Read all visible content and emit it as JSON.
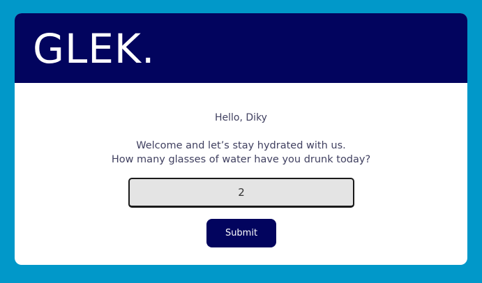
{
  "header": {
    "logo_text": "GLEK."
  },
  "main": {
    "greeting": "Hello, Diky",
    "welcome_line_1": "Welcome and let’s stay hydrated with us.",
    "welcome_line_2": "How many glasses of water have you drunk today?",
    "glasses_input": {
      "value": "2"
    },
    "submit_label": "Submit"
  },
  "colors": {
    "background": "#0198c9",
    "header": "#02045e",
    "button": "#02045e",
    "input_bg": "#e4e4e4"
  }
}
